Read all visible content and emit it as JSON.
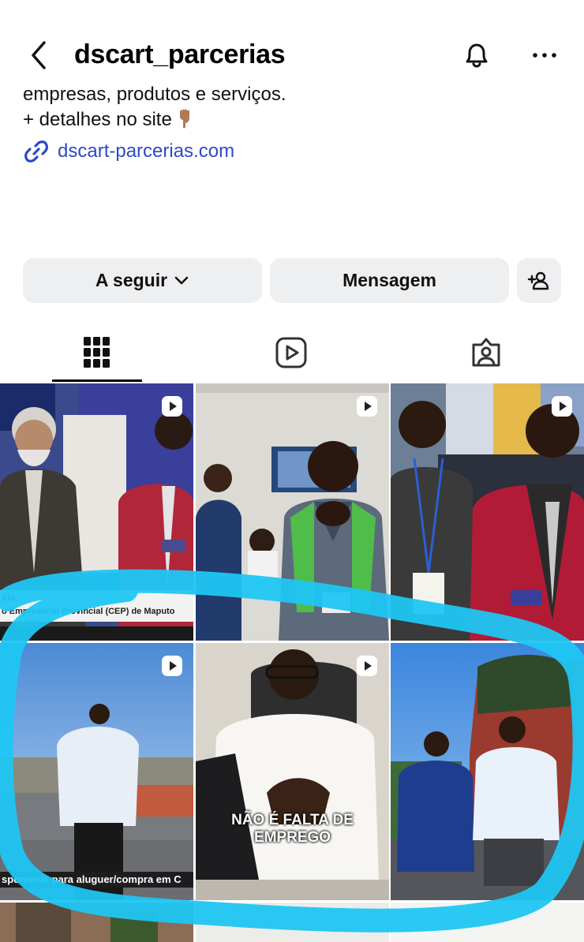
{
  "header": {
    "username": "dscart_parcerias",
    "back_icon": "chevron-left-icon",
    "bell_icon": "bell-icon",
    "more_icon": "more-horizontal-icon"
  },
  "bio": {
    "line1": "empresas, produtos e serviços.",
    "line2": "+ detalhes no site",
    "emoji": "pointing-down-hand-emoji",
    "link_icon": "link-icon",
    "link_text": "dscart-parcerias.com"
  },
  "actions": {
    "follow_label": "A seguir",
    "message_label": "Mensagem",
    "add_user_icon": "add-user-icon"
  },
  "tabs": [
    {
      "name": "grid",
      "icon": "grid-icon",
      "selected": true
    },
    {
      "name": "reels",
      "icon": "reels-icon",
      "selected": false
    },
    {
      "name": "tagged",
      "icon": "tagged-person-icon",
      "selected": false
    }
  ],
  "posts": [
    {
      "caption_line1": "AM",
      "caption_line2": "o Empresarial Provincial (CEP) de Maputo",
      "reel": true
    },
    {
      "reel": true
    },
    {
      "reel": true
    },
    {
      "caption_line1": "sponiveis para aluguer/compra em C",
      "reel": true
    },
    {
      "overlay_text": "NÃO É FALTA DE EMPREGO",
      "reel": true
    },
    {
      "reel": false
    }
  ],
  "colors": {
    "link": "#2d4ac7",
    "button_bg": "#eeeff1",
    "marker": "#1fc6f3"
  }
}
